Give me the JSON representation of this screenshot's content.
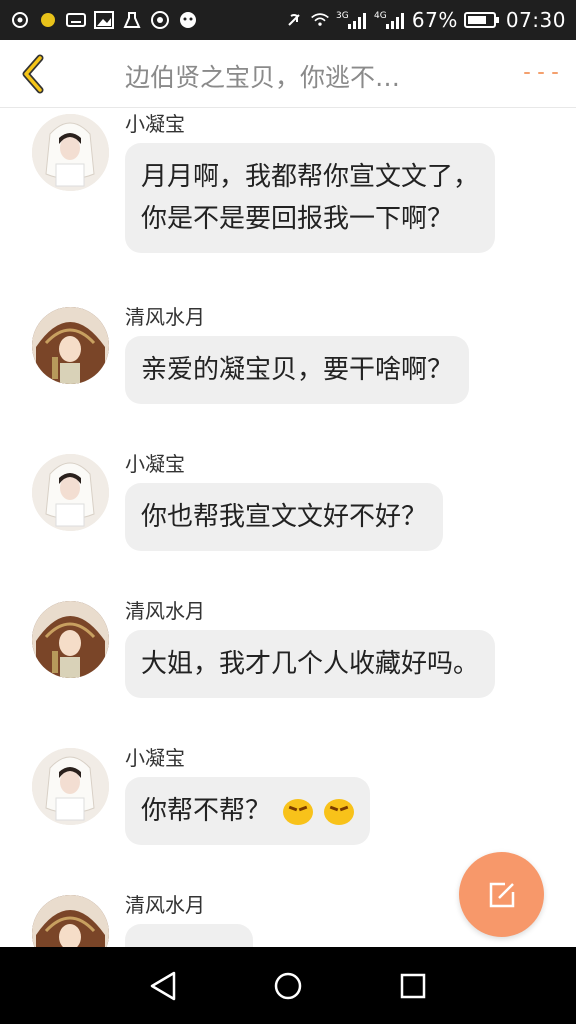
{
  "status_bar": {
    "network_3g": "3G",
    "network_4g": "4G",
    "battery_percent": "67%",
    "time": "07:30",
    "icons_left": [
      "location-icon",
      "notification-icon",
      "keyboard-icon",
      "gallery-icon",
      "cleaner-icon",
      "app-icon",
      "assistant-icon"
    ],
    "icons_right": [
      "mute-icon",
      "wifi-icon",
      "signal-3g-icon",
      "signal-4g-icon",
      "battery-icon"
    ]
  },
  "header": {
    "title": "边伯贤之宝贝，你逃不…",
    "accent_color": "#f4a06e"
  },
  "messages": [
    {
      "sender": "小凝宝",
      "text_lines": [
        "月月啊，我都帮你宣文文了，",
        "你是不是要回报我一下啊？"
      ],
      "avatar": "avatar-girl-white"
    },
    {
      "sender": "清风水月",
      "text_lines": [
        "亲爱的凝宝贝，要干啥啊？"
      ],
      "avatar": "avatar-girl-brown"
    },
    {
      "sender": "小凝宝",
      "text_lines": [
        "你也帮我宣文文好不好？"
      ],
      "avatar": "avatar-girl-white"
    },
    {
      "sender": "清风水月",
      "text_lines": [
        "大姐，我才几个人收藏好吗。"
      ],
      "avatar": "avatar-girl-brown"
    },
    {
      "sender": "小凝宝",
      "text_lines": [
        "你帮不帮？"
      ],
      "emoji": [
        "angry-emoji",
        "angry-emoji"
      ],
      "avatar": "avatar-girl-white"
    },
    {
      "sender": "清风水月",
      "text_lines": [
        ""
      ],
      "avatar": "avatar-girl-brown"
    }
  ],
  "fab": {
    "icon": "edit-icon",
    "color": "#f7986a"
  },
  "nav": {
    "icons": [
      "back-triangle-icon",
      "home-circle-icon",
      "recents-square-icon"
    ]
  }
}
